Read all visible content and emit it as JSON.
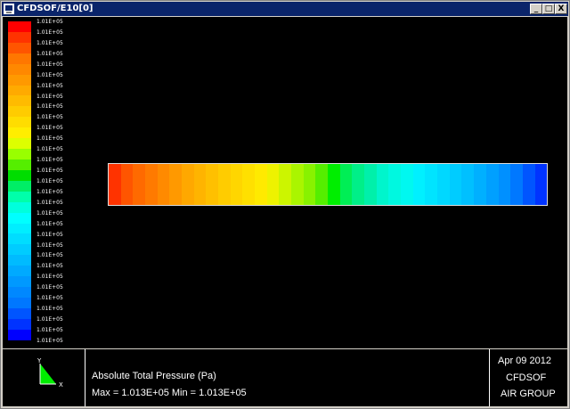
{
  "window": {
    "title": "CFDSOF/E10[0]",
    "buttons": [
      "_",
      "□",
      "X"
    ]
  },
  "legend": {
    "labels": [
      "1.01E+05",
      "1.01E+05",
      "1.01E+05",
      "1.01E+05",
      "1.01E+05",
      "1.01E+05",
      "1.01E+05",
      "1.01E+05",
      "1.01E+05",
      "1.01E+05",
      "1.01E+05",
      "1.01E+05",
      "1.01E+05",
      "1.01E+05",
      "1.01E+05",
      "1.01E+05",
      "1.01E+05",
      "1.01E+05",
      "1.01E+05",
      "1.01E+05",
      "1.01E+05",
      "1.01E+05",
      "1.01E+05",
      "1.01E+05",
      "1.01E+05",
      "1.01E+05",
      "1.01E+05",
      "1.01E+05",
      "1.01E+05",
      "1.01E+05",
      "1.01E+05"
    ],
    "colors": [
      "#ff0000",
      "#ff3300",
      "#ff5500",
      "#ff7700",
      "#ff8800",
      "#ff9900",
      "#ffaa00",
      "#ffbb00",
      "#ffcc00",
      "#ffdd00",
      "#ffee00",
      "#ddff00",
      "#99ff00",
      "#55ee00",
      "#00dd00",
      "#00ee66",
      "#00ffaa",
      "#00ffdd",
      "#00ffff",
      "#00eeff",
      "#00ddff",
      "#00ccff",
      "#00bbff",
      "#00aaff",
      "#0099ff",
      "#0088ff",
      "#0077ff",
      "#0055ff",
      "#0033ff",
      "#0000ff"
    ]
  },
  "pipe": {
    "colors": [
      "#ff3300",
      "#ff5500",
      "#ff6a00",
      "#ff7a00",
      "#ff8a00",
      "#ff9900",
      "#ffa800",
      "#ffb400",
      "#ffc000",
      "#ffcc00",
      "#ffd600",
      "#ffe000",
      "#ffea00",
      "#eef200",
      "#ccf500",
      "#aaf500",
      "#88f200",
      "#55ee00",
      "#00ee00",
      "#00ee55",
      "#00ef88",
      "#00f0aa",
      "#00f5cc",
      "#00f8e0",
      "#00f8f0",
      "#00f0ff",
      "#00e4ff",
      "#00d8ff",
      "#00ccff",
      "#00c0ff",
      "#00b0ff",
      "#00a0ff",
      "#0090ff",
      "#0078ff",
      "#0055ff",
      "#0033ff"
    ]
  },
  "footer": {
    "axis_y": "Y",
    "axis_x": "X",
    "variable": "Absolute Total Pressure (Pa)",
    "range": "Max = 1.013E+05   Min = 1.013E+05",
    "date": "Apr 09 2012",
    "software": "CFDSOF",
    "group": "AIR GROUP"
  }
}
